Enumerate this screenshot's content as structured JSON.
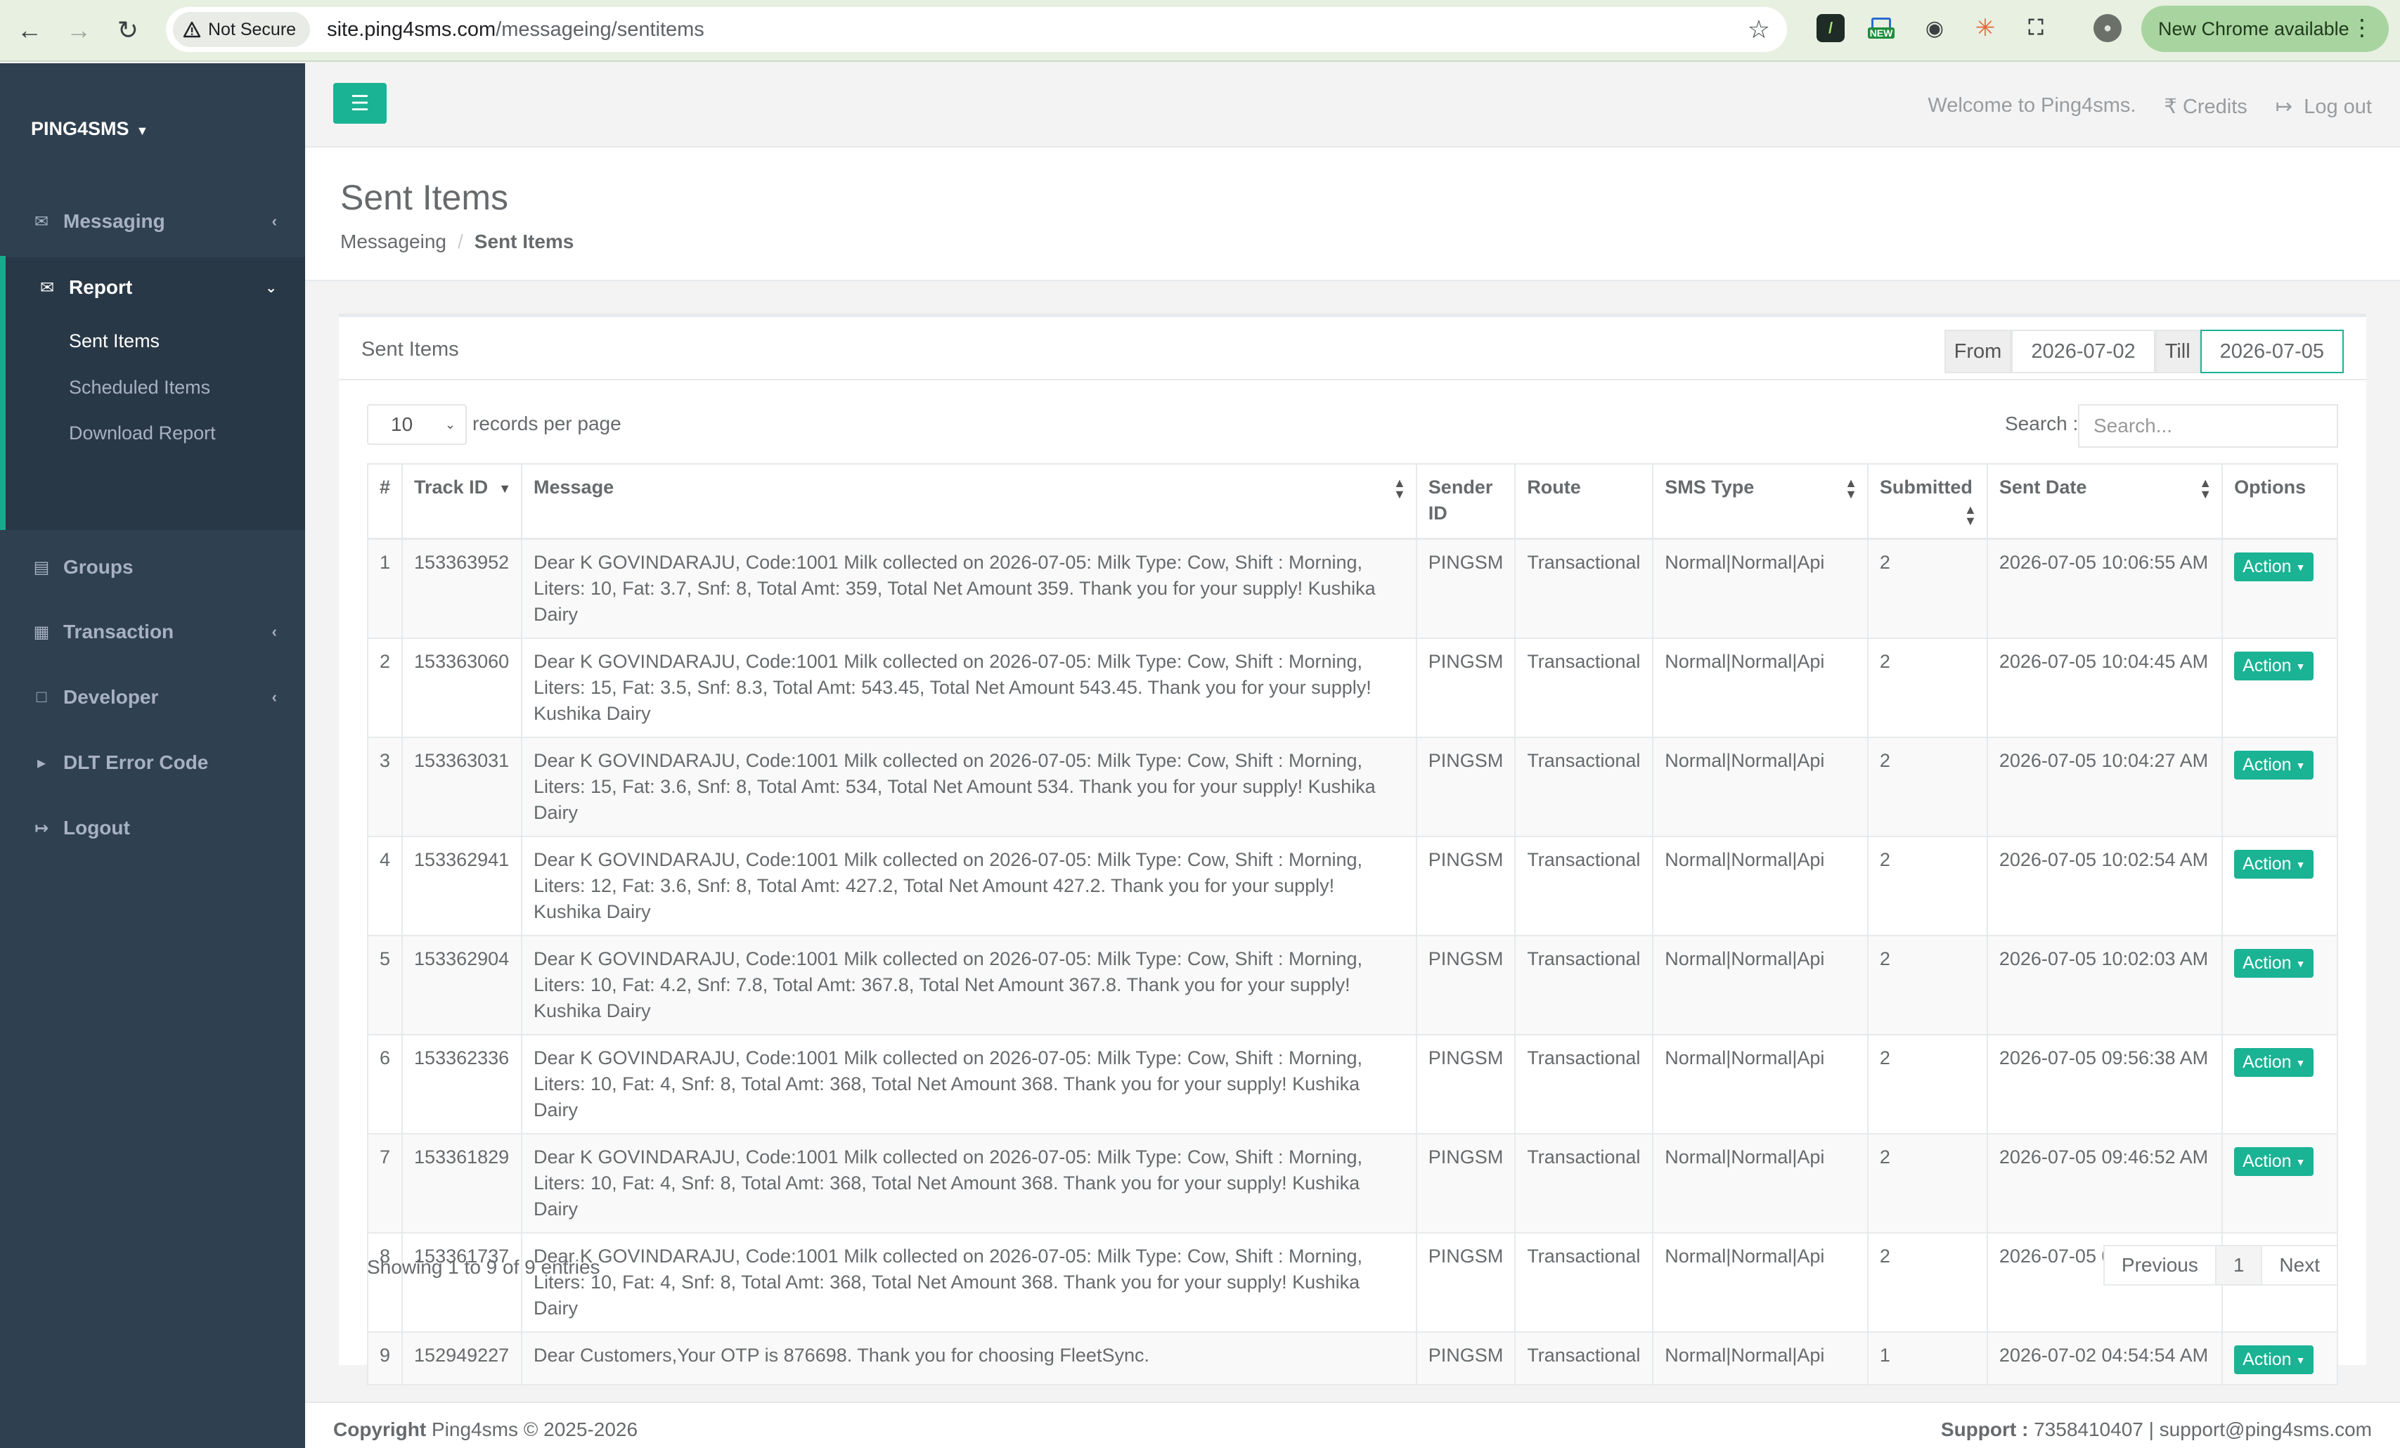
{
  "browser": {
    "security_label": "Not Secure",
    "url_host": "site.ping4sms.com",
    "url_path": "/messageing/sentitems",
    "update_label": "New Chrome available",
    "new_badge": "NEW"
  },
  "sidebar": {
    "brand": "PING4SMS",
    "items": [
      {
        "label": "Messaging"
      },
      {
        "label": "Report"
      },
      {
        "label": "Groups"
      },
      {
        "label": "Transaction"
      },
      {
        "label": "Developer"
      },
      {
        "label": "DLT Error Code"
      },
      {
        "label": "Logout"
      }
    ],
    "report_sub": [
      {
        "label": "Sent Items"
      },
      {
        "label": "Scheduled Items"
      },
      {
        "label": "Download Report"
      }
    ]
  },
  "topbar": {
    "welcome": "Welcome to Ping4sms.",
    "credits": "Credits",
    "logout": "Log out"
  },
  "heading": {
    "title": "Sent Items",
    "crumb_parent": "Messageing",
    "crumb_current": "Sent Items"
  },
  "panel": {
    "title": "Sent Items",
    "from_label": "From",
    "from_value": "2026-07-02",
    "till_label": "Till",
    "till_value": "2026-07-05",
    "page_length": "10",
    "records_per_page": "records per page",
    "search_label": "Search :",
    "search_placeholder": "Search..."
  },
  "table": {
    "headers": [
      "#",
      "Track ID",
      "Message",
      "Sender ID",
      "Route",
      "SMS Type",
      "Submitted",
      "Sent Date",
      "Options"
    ],
    "action_label": "Action",
    "rows": [
      {
        "n": "1",
        "track": "153363952",
        "msg": "Dear K GOVINDARAJU, Code:1001 Milk collected on 2026-07-05: Milk Type: Cow, Shift : Morning, Liters: 10, Fat: 3.7, Snf: 8, Total Amt: 359, Total Net Amount 359. Thank you for your supply! Kushika Dairy",
        "sender": "PINGSM",
        "route": "Transactional",
        "type": "Normal|Normal|Api",
        "submitted": "2",
        "date": "2026-07-05 10:06:55 AM"
      },
      {
        "n": "2",
        "track": "153363060",
        "msg": "Dear K GOVINDARAJU, Code:1001 Milk collected on 2026-07-05: Milk Type: Cow, Shift : Morning, Liters: 15, Fat: 3.5, Snf: 8.3, Total Amt: 543.45, Total Net Amount 543.45. Thank you for your supply! Kushika Dairy",
        "sender": "PINGSM",
        "route": "Transactional",
        "type": "Normal|Normal|Api",
        "submitted": "2",
        "date": "2026-07-05 10:04:45 AM"
      },
      {
        "n": "3",
        "track": "153363031",
        "msg": "Dear K GOVINDARAJU, Code:1001 Milk collected on 2026-07-05: Milk Type: Cow, Shift : Morning, Liters: 15, Fat: 3.6, Snf: 8, Total Amt: 534, Total Net Amount 534. Thank you for your supply! Kushika Dairy",
        "sender": "PINGSM",
        "route": "Transactional",
        "type": "Normal|Normal|Api",
        "submitted": "2",
        "date": "2026-07-05 10:04:27 AM"
      },
      {
        "n": "4",
        "track": "153362941",
        "msg": "Dear K GOVINDARAJU, Code:1001 Milk collected on 2026-07-05: Milk Type: Cow, Shift : Morning, Liters: 12, Fat: 3.6, Snf: 8, Total Amt: 427.2, Total Net Amount 427.2. Thank you for your supply! Kushika Dairy",
        "sender": "PINGSM",
        "route": "Transactional",
        "type": "Normal|Normal|Api",
        "submitted": "2",
        "date": "2026-07-05 10:02:54 AM"
      },
      {
        "n": "5",
        "track": "153362904",
        "msg": "Dear K GOVINDARAJU, Code:1001 Milk collected on 2026-07-05: Milk Type: Cow, Shift : Morning, Liters: 10, Fat: 4.2, Snf: 7.8, Total Amt: 367.8, Total Net Amount 367.8. Thank you for your supply! Kushika Dairy",
        "sender": "PINGSM",
        "route": "Transactional",
        "type": "Normal|Normal|Api",
        "submitted": "2",
        "date": "2026-07-05 10:02:03 AM"
      },
      {
        "n": "6",
        "track": "153362336",
        "msg": "Dear K GOVINDARAJU, Code:1001 Milk collected on 2026-07-05: Milk Type: Cow, Shift : Morning, Liters: 10, Fat: 4, Snf: 8, Total Amt: 368, Total Net Amount 368. Thank you for your supply! Kushika Dairy",
        "sender": "PINGSM",
        "route": "Transactional",
        "type": "Normal|Normal|Api",
        "submitted": "2",
        "date": "2026-07-05 09:56:38 AM"
      },
      {
        "n": "7",
        "track": "153361829",
        "msg": "Dear K GOVINDARAJU, Code:1001 Milk collected on 2026-07-05: Milk Type: Cow, Shift : Morning, Liters: 10, Fat: 4, Snf: 8, Total Amt: 368, Total Net Amount 368. Thank you for your supply! Kushika Dairy",
        "sender": "PINGSM",
        "route": "Transactional",
        "type": "Normal|Normal|Api",
        "submitted": "2",
        "date": "2026-07-05 09:46:52 AM"
      },
      {
        "n": "8",
        "track": "153361737",
        "msg": "Dear K GOVINDARAJU, Code:1001 Milk collected on 2026-07-05: Milk Type: Cow, Shift : Morning, Liters: 10, Fat: 4, Snf: 8, Total Amt: 368, Total Net Amount 368. Thank you for your supply! Kushika Dairy",
        "sender": "PINGSM",
        "route": "Transactional",
        "type": "Normal|Normal|Api",
        "submitted": "2",
        "date": "2026-07-05 09:45:32 AM"
      },
      {
        "n": "9",
        "track": "152949227",
        "msg": "Dear Customers,Your OTP is 876698. Thank you for choosing FleetSync.",
        "sender": "PINGSM",
        "route": "Transactional",
        "type": "Normal|Normal|Api",
        "submitted": "1",
        "date": "2026-07-02 04:54:54 AM"
      }
    ]
  },
  "pagination": {
    "info": "Showing 1 to 9 of 9 entries",
    "previous": "Previous",
    "page": "1",
    "next": "Next"
  },
  "footer": {
    "copyright_label": "Copyright",
    "copyright_text": "Ping4sms © 2025-2026",
    "support_label": "Support :",
    "support_text": "7358410407 | support@ping4sms.com"
  },
  "colors": {
    "accent": "#1ab394",
    "sidebar": "#2f4050",
    "sidebar_active": "#293846"
  }
}
